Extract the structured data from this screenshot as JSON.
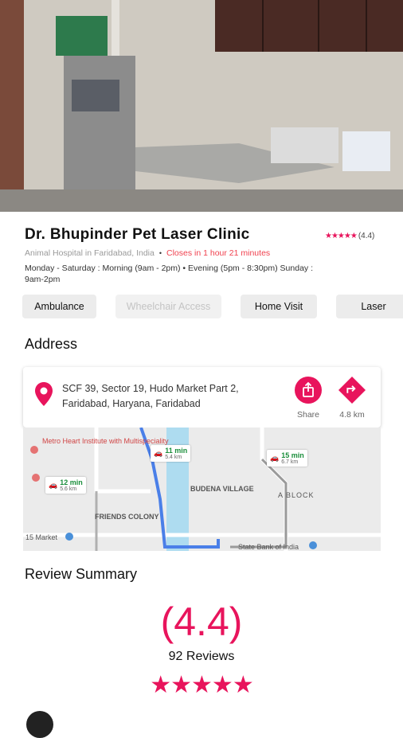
{
  "clinic": {
    "name": "Dr. Bhupinder Pet Laser Clinic",
    "rating_stars": "★★★★★",
    "rating_value": "(4.4)",
    "category": "Animal Hospital in Faridabad, India",
    "separator": "•",
    "closing": "Closes in 1 hour 21 minutes",
    "hours": "Monday - Saturday : Morning (9am - 2pm) • Evening (5pm - 8:30pm) Sunday : 9am-2pm"
  },
  "chips": [
    {
      "label": "Ambulance",
      "enabled": true
    },
    {
      "label": "Wheelchair Access",
      "enabled": false
    },
    {
      "label": "Home Visit",
      "enabled": true
    },
    {
      "label": "Laser",
      "enabled": true
    }
  ],
  "address": {
    "heading": "Address",
    "text": "SCF 39, Sector 19, Hudo Market Part 2, Faridabad, Haryana, Faridabad",
    "share_label": "Share",
    "distance_label": "4.8 km"
  },
  "map": {
    "labels": [
      "Metro Heart Institute with Multispeciality",
      "BUDENA VILLAGE",
      "FRIENDS COLONY",
      "A BLOCK",
      "15 Market",
      "State Bank of India"
    ],
    "etas": [
      {
        "time": "11 min",
        "dist": "5.4 km"
      },
      {
        "time": "15 min",
        "dist": "6.7 km"
      },
      {
        "time": "12 min",
        "dist": "5.6 km"
      }
    ]
  },
  "review": {
    "heading": "Review Summary",
    "value": "(4.4)",
    "count": "92 Reviews",
    "stars": "★★★★★"
  },
  "colors": {
    "accent": "#e8145c",
    "closing": "#f0424f",
    "route": "#4a7fe8"
  }
}
